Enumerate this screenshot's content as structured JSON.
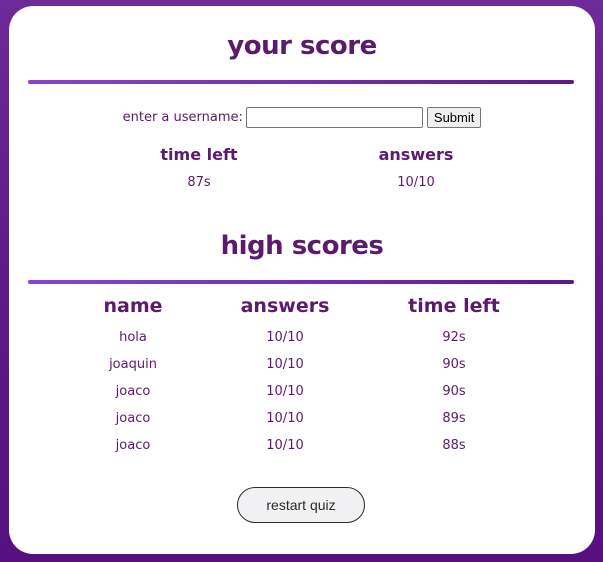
{
  "score": {
    "title": "your score",
    "username_label": "enter a username:",
    "username_value": "",
    "submit_label": "Submit",
    "headers": {
      "time_left": "time left",
      "answers": "answers"
    },
    "values": {
      "time_left": "87s",
      "answers": "10/10"
    }
  },
  "high_scores": {
    "title": "high scores",
    "columns": [
      "name",
      "answers",
      "time left"
    ],
    "rows": [
      {
        "name": "hola",
        "answers": "10/10",
        "time_left": "92s"
      },
      {
        "name": "joaquin",
        "answers": "10/10",
        "time_left": "90s"
      },
      {
        "name": "joaco",
        "answers": "10/10",
        "time_left": "90s"
      },
      {
        "name": "joaco",
        "answers": "10/10",
        "time_left": "89s"
      },
      {
        "name": "joaco",
        "answers": "10/10",
        "time_left": "88s"
      }
    ]
  },
  "restart_label": "restart quiz",
  "colors": {
    "heading": "#5c1a6e",
    "accent_start": "#8a45cc",
    "accent_end": "#5e1a86"
  }
}
